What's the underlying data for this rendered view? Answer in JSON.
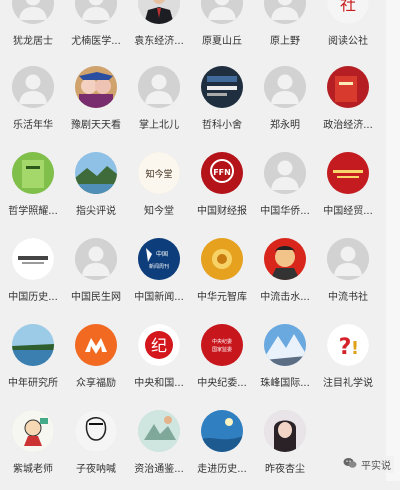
{
  "rows": [
    {
      "items": [
        {
          "label": "犹龙居士",
          "avatar": "default"
        },
        {
          "label": "尤楠医学...",
          "avatar": "default"
        },
        {
          "label": "袁东经济...",
          "avatar": "portrait-man"
        },
        {
          "label": "原夏山丘",
          "avatar": "default"
        },
        {
          "label": "原上野",
          "avatar": "default"
        },
        {
          "label": "阅读公社",
          "avatar": "red-seal"
        }
      ]
    },
    {
      "items": [
        {
          "label": "乐活年华",
          "avatar": "default"
        },
        {
          "label": "豫剧天天看",
          "avatar": "opera"
        },
        {
          "label": "掌上北儿",
          "avatar": "default"
        },
        {
          "label": "哲科小舍",
          "avatar": "dark-card"
        },
        {
          "label": "郑永明",
          "avatar": "default"
        },
        {
          "label": "政治经济...",
          "avatar": "red-book"
        }
      ]
    },
    {
      "items": [
        {
          "label": "哲学照耀...",
          "avatar": "green-book"
        },
        {
          "label": "指尖评说",
          "avatar": "landscape"
        },
        {
          "label": "知今堂",
          "avatar": "zhijintang",
          "text": "知今堂"
        },
        {
          "label": "中国财经报",
          "avatar": "ffn",
          "text": "FFN"
        },
        {
          "label": "中国华侨...",
          "avatar": "default"
        },
        {
          "label": "中国经贸...",
          "avatar": "red-journal"
        }
      ]
    },
    {
      "items": [
        {
          "label": "中国历史...",
          "avatar": "white-card"
        },
        {
          "label": "中国民生网",
          "avatar": "default"
        },
        {
          "label": "中国新闻...",
          "avatar": "cns",
          "text": "中国新闻周刊"
        },
        {
          "label": "中华元智库",
          "avatar": "gold"
        },
        {
          "label": "中流击水...",
          "avatar": "mao"
        },
        {
          "label": "中流书社",
          "avatar": "default"
        }
      ]
    },
    {
      "items": [
        {
          "label": "中年研究所",
          "avatar": "lake"
        },
        {
          "label": "众享福励",
          "avatar": "orange-logo"
        },
        {
          "label": "中央和国...",
          "avatar": "ji-logo",
          "text": "纪"
        },
        {
          "label": "中央纪委...",
          "avatar": "ccdi",
          "text": "中央纪委国家监委"
        },
        {
          "label": "珠峰国际...",
          "avatar": "mountain"
        },
        {
          "label": "注目礼学说",
          "avatar": "question"
        }
      ]
    },
    {
      "items": [
        {
          "label": "紫城老师",
          "avatar": "cartoon"
        },
        {
          "label": "子夜呐喊",
          "avatar": "sketch"
        },
        {
          "label": "资治通鉴...",
          "avatar": "painting"
        },
        {
          "label": "走进历史...",
          "avatar": "blue-sky"
        },
        {
          "label": "昨夜杏尘",
          "avatar": "girl"
        }
      ]
    }
  ],
  "watermark": {
    "label": "平实说",
    "icon": "wechat-icon"
  }
}
